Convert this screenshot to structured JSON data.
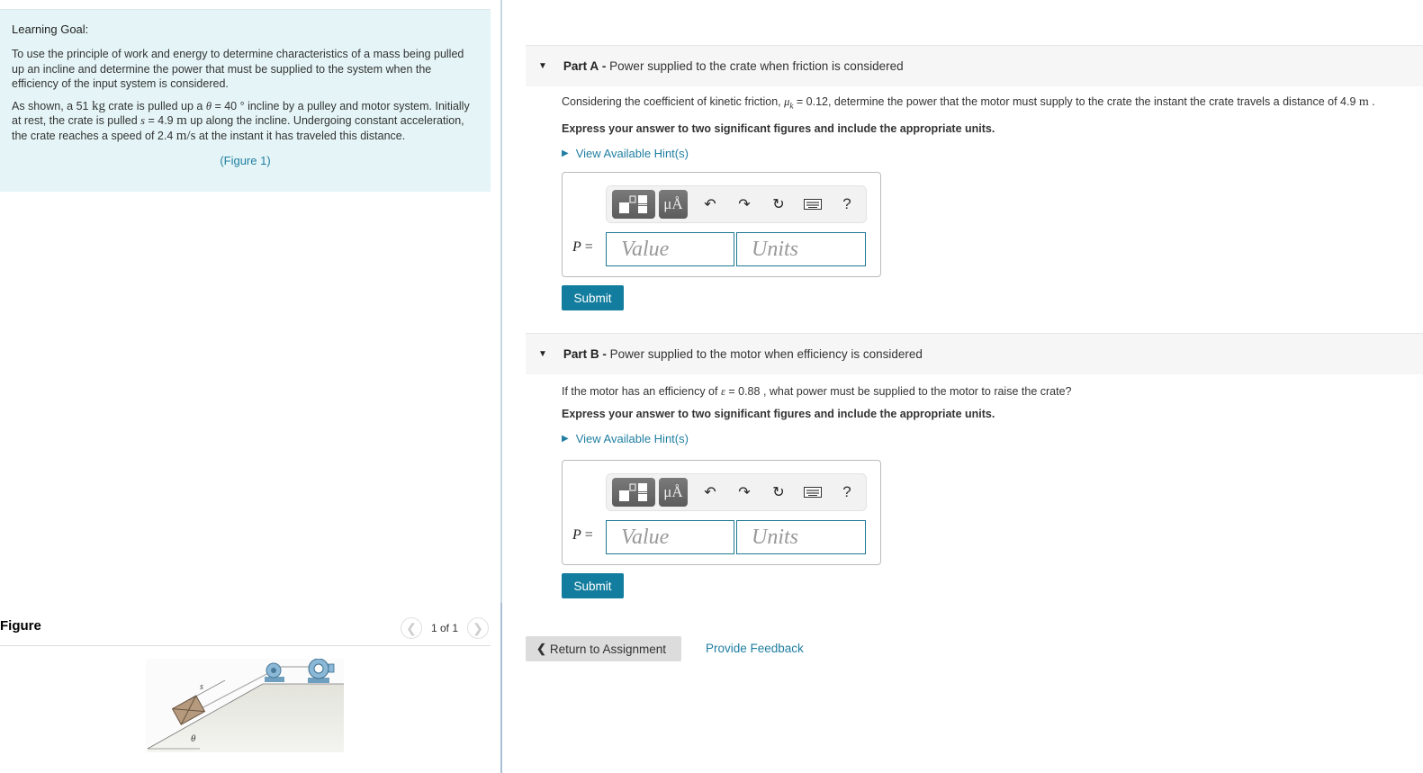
{
  "learning_goal": {
    "heading": "Learning Goal:",
    "paragraph1": "To use the principle of work and energy to determine characteristics of a mass being pulled up an incline and determine the power that must be supplied to the system when the efficiency of the input system is considered.",
    "p2_a": "As shown, a 51 ",
    "p2_kg": "kg",
    "p2_b": " crate is pulled up a ",
    "p2_theta": "θ",
    "p2_c": " = 40 ° incline by a pulley and motor system. Initially at rest, the crate is pulled ",
    "p2_s": "s",
    "p2_d": " = 4.9 ",
    "p2_m": "m",
    "p2_e": " up along the incline. Undergoing constant acceleration, the crate reaches a speed of 2.4 ",
    "p2_ms": "m/s",
    "p2_f": " at the instant it has traveled this distance.",
    "figure_link": "(Figure 1)"
  },
  "figure": {
    "title": "Figure",
    "pagination": "1 of 1",
    "prev_icon": "chevron-left-icon",
    "next_icon": "chevron-right-icon",
    "labels": {
      "s": "s",
      "theta": "θ"
    }
  },
  "parts": [
    {
      "label": "Part A",
      "sep": " - ",
      "title": "Power supplied to the crate when friction is considered",
      "question_a": "Considering the coefficient of kinetic friction, ",
      "question_sym": "μ",
      "question_sub": "k",
      "question_b": " = 0.12, determine the power that the motor must supply to the crate the instant the crate travels a distance of 4.9 ",
      "question_unit": "m",
      "question_c": " .",
      "instructions": "Express your answer to two significant figures and include the appropriate units.",
      "hint": "View Available Hint(s)",
      "variable": "P",
      "equals": " =",
      "value_placeholder": "Value",
      "units_placeholder": "Units",
      "submit": "Submit"
    },
    {
      "label": "Part B",
      "sep": " - ",
      "title": "Power supplied to the motor when efficiency is considered",
      "question_a": "If the motor has an efficiency of ",
      "question_sym": "ε",
      "question_b": " = 0.88 , what power must be supplied to the motor to raise the crate?",
      "instructions": "Express your answer to two significant figures and include the appropriate units.",
      "hint": "View Available Hint(s)",
      "variable": "P",
      "equals": " =",
      "value_placeholder": "Value",
      "units_placeholder": "Units",
      "submit": "Submit"
    }
  ],
  "toolbar": {
    "units_btn": "μÅ",
    "help": "?"
  },
  "footer": {
    "return": "Return to Assignment",
    "feedback": "Provide Feedback"
  },
  "colors": {
    "accent": "#127d9e",
    "link": "#1f7ea1",
    "goal_bg": "#e5f5f7"
  }
}
